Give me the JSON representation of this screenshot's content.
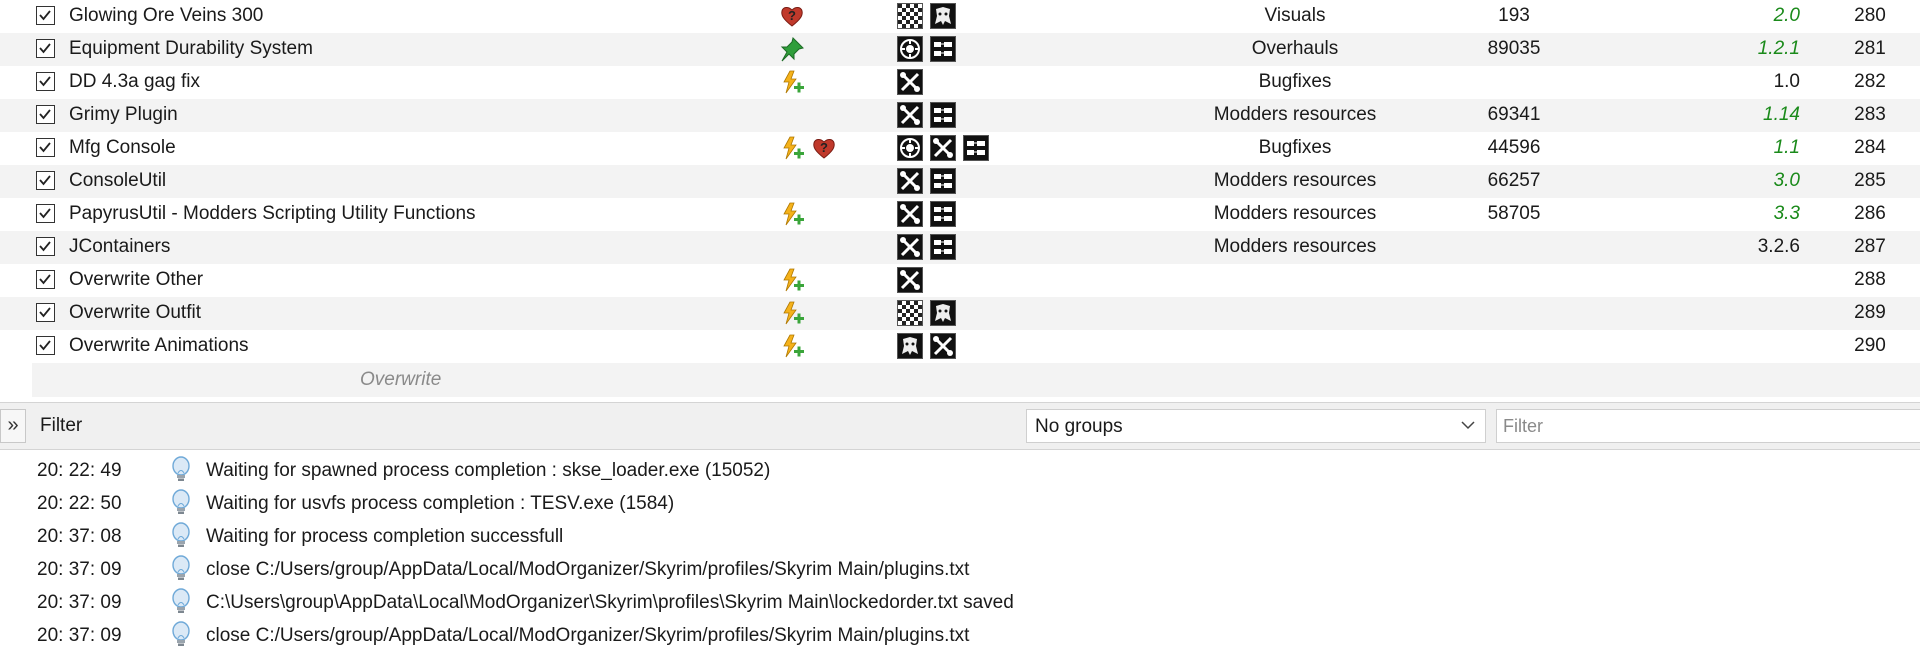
{
  "mods": [
    {
      "name": "Glowing Ore Veins 300",
      "flags": [
        "heart-question-icon"
      ],
      "contents": [
        "checker-icon",
        "textures-icon"
      ],
      "category": "Visuals",
      "nexus_id": "193",
      "version": "2.0",
      "version_green": true,
      "priority": "280"
    },
    {
      "name": "Equipment Durability System",
      "flags": [
        "pin-icon"
      ],
      "contents": [
        "gear-circle-icon",
        "plugin-icon"
      ],
      "category": "Overhauls",
      "nexus_id": "89035",
      "version": "1.2.1",
      "version_green": true,
      "priority": "281"
    },
    {
      "name": "DD 4.3a gag fix",
      "flags": [
        "conflict-plus-icon"
      ],
      "contents": [
        "tools-icon"
      ],
      "category": "Bugfixes",
      "nexus_id": "",
      "version": "1.0",
      "version_green": false,
      "priority": "282"
    },
    {
      "name": "Grimy Plugin",
      "flags": [],
      "contents": [
        "tools-icon",
        "plugin-icon"
      ],
      "category": "Modders resources",
      "nexus_id": "69341",
      "version": "1.14",
      "version_green": true,
      "priority": "283"
    },
    {
      "name": "Mfg Console",
      "flags": [
        "conflict-plus-icon",
        "heart-question-icon"
      ],
      "contents": [
        "gear-circle-icon",
        "tools-icon",
        "plugin-icon"
      ],
      "category": "Bugfixes",
      "nexus_id": "44596",
      "version": "1.1",
      "version_green": true,
      "priority": "284"
    },
    {
      "name": "ConsoleUtil",
      "flags": [],
      "contents": [
        "tools-icon",
        "plugin-icon"
      ],
      "category": "Modders resources",
      "nexus_id": "66257",
      "version": "3.0",
      "version_green": true,
      "priority": "285"
    },
    {
      "name": "PapyrusUtil - Modders Scripting Utility Functions",
      "flags": [
        "conflict-plus-icon"
      ],
      "contents": [
        "tools-icon",
        "plugin-icon"
      ],
      "category": "Modders resources",
      "nexus_id": "58705",
      "version": "3.3",
      "version_green": true,
      "priority": "286"
    },
    {
      "name": "JContainers",
      "flags": [],
      "contents": [
        "tools-icon",
        "plugin-icon"
      ],
      "category": "Modders resources",
      "nexus_id": "",
      "version": "3.2.6",
      "version_green": false,
      "priority": "287"
    },
    {
      "name": "Overwrite Other",
      "flags": [
        "conflict-plus-icon"
      ],
      "contents": [
        "tools-icon"
      ],
      "category": "",
      "nexus_id": "",
      "version": "",
      "version_green": false,
      "priority": "288"
    },
    {
      "name": "Overwrite Outfit",
      "flags": [
        "conflict-plus-icon"
      ],
      "contents": [
        "checker-icon",
        "textures-icon"
      ],
      "category": "",
      "nexus_id": "",
      "version": "",
      "version_green": false,
      "priority": "289"
    },
    {
      "name": "Overwrite Animations",
      "flags": [
        "conflict-plus-icon"
      ],
      "contents": [
        "textures-icon",
        "tools-icon"
      ],
      "category": "",
      "nexus_id": "",
      "version": "",
      "version_green": false,
      "priority": "290"
    }
  ],
  "overwrite_label": "Overwrite",
  "filterbar": {
    "expand_glyph": "»",
    "filter_label": "Filter",
    "groups_value": "No groups",
    "filter_placeholder": "Filter"
  },
  "log": [
    {
      "time": "20: 22: 49",
      "message": "Waiting for spawned process completion : skse_loader.exe (15052)"
    },
    {
      "time": "20: 22: 50",
      "message": "Waiting for usvfs process completion : TESV.exe (1584)"
    },
    {
      "time": "20: 37: 08",
      "message": "Waiting for process completion successfull"
    },
    {
      "time": "20: 37: 09",
      "message": "close C:/Users/group/AppData/Local/ModOrganizer/Skyrim/profiles/Skyrim Main/plugins.txt"
    },
    {
      "time": "20: 37: 09",
      "message": "C:\\Users\\group\\AppData\\Local\\ModOrganizer\\Skyrim\\profiles\\Skyrim Main\\lockedorder.txt saved"
    },
    {
      "time": "20: 37: 09",
      "message": "close C:/Users/group/AppData/Local/ModOrganizer/Skyrim/profiles/Skyrim Main/plugins.txt"
    }
  ],
  "colors": {
    "version_green": "#1a8a1a",
    "row_alt": "#f3f3f3",
    "log_icon": "#6fa9d8"
  }
}
